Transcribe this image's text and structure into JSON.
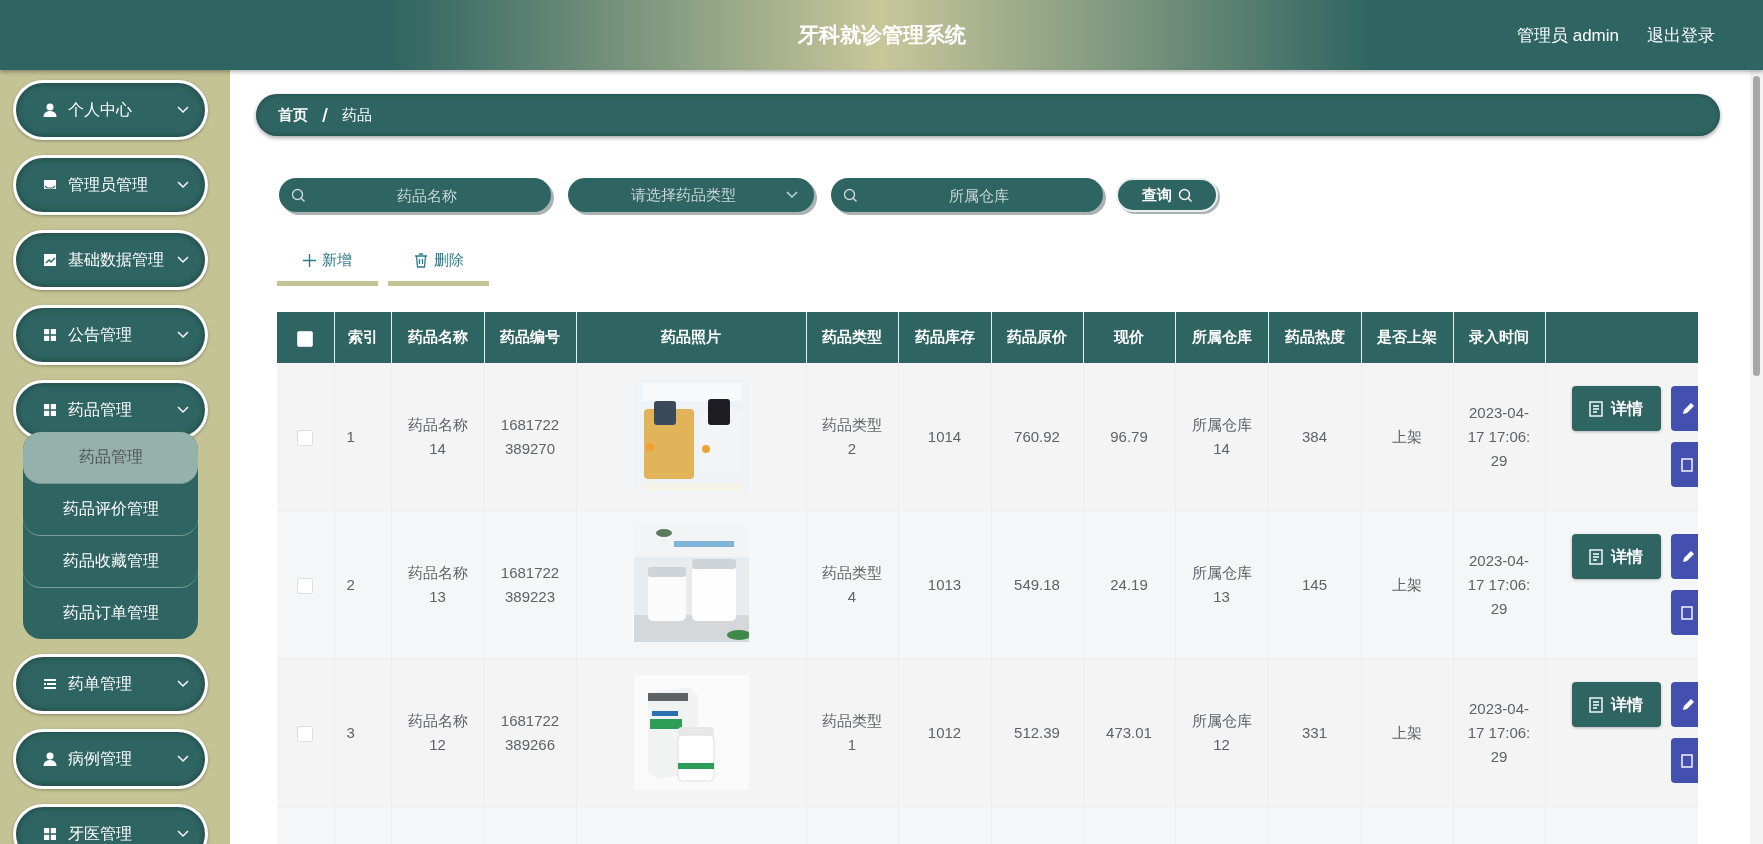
{
  "header": {
    "title": "牙科就诊管理系统",
    "user": "管理员 admin",
    "logout": "退出登录"
  },
  "sidebar": {
    "items": [
      {
        "label": "个人中心"
      },
      {
        "label": "管理员管理"
      },
      {
        "label": "基础数据管理"
      },
      {
        "label": "公告管理"
      },
      {
        "label": "药品管理",
        "children": [
          {
            "label": "药品管理",
            "selected": true
          },
          {
            "label": "药品评价管理",
            "selected": false
          },
          {
            "label": "药品收藏管理",
            "selected": false
          },
          {
            "label": "药品订单管理",
            "selected": false
          }
        ]
      },
      {
        "label": "药单管理"
      },
      {
        "label": "病例管理"
      },
      {
        "label": "牙医管理"
      }
    ]
  },
  "breadcrumb": [
    "首页",
    "药品"
  ],
  "filters": [
    {
      "kind": "input",
      "placeholder": "药品名称"
    },
    {
      "kind": "select",
      "placeholder": "请选择药品类型"
    },
    {
      "kind": "input",
      "placeholder": "所属仓库"
    }
  ],
  "search_button": "查询",
  "actions": [
    {
      "kind": "add",
      "label": "新增"
    },
    {
      "kind": "delete",
      "label": "删除"
    }
  ],
  "table": {
    "all_checked": false,
    "columns": [
      "索引",
      "药品名称",
      "药品编号",
      "药品照片",
      "药品类型",
      "药品库存",
      "药品原价",
      "现价",
      "所属仓库",
      "药品热度",
      "是否上架",
      "录入时间"
    ],
    "rows": [
      {
        "checked": false,
        "cells": [
          "1",
          "药品名称14",
          "1681722389270",
          {
            "kind": "picture"
          },
          "药品类型2",
          "1014",
          "760.92",
          "96.79",
          "所属仓库14",
          "384",
          "上架",
          "2023-04-17 17:06:29"
        ],
        "detail": "详情"
      },
      {
        "checked": false,
        "cells": [
          "2",
          "药品名称13",
          "1681722389223",
          {
            "kind": "picture"
          },
          "药品类型4",
          "1013",
          "549.18",
          "24.19",
          "所属仓库13",
          "145",
          "上架",
          "2023-04-17 17:06:29"
        ],
        "detail": "详情"
      },
      {
        "checked": false,
        "cells": [
          "3",
          "药品名称12",
          "1681722389266",
          {
            "kind": "picture"
          },
          "药品类型1",
          "1012",
          "512.39",
          "473.01",
          "所属仓库12",
          "331",
          "上架",
          "2023-04-17 17:06:29"
        ],
        "detail": "详情"
      }
    ]
  }
}
